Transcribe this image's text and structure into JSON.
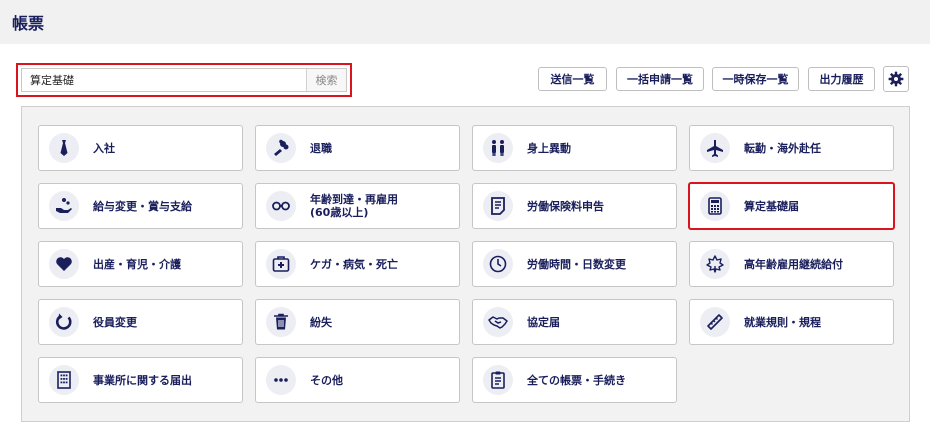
{
  "page": {
    "title": "帳票"
  },
  "search": {
    "value": "算定基礎",
    "button_label": "検索"
  },
  "toolbar": {
    "buttons": [
      {
        "label": "送信一覧"
      },
      {
        "label": "一括申請一覧"
      },
      {
        "label": "一時保存一覧"
      },
      {
        "label": "出力履歴"
      }
    ],
    "settings_icon": "gear-icon"
  },
  "tiles": [
    {
      "label": "入社",
      "icon": "necktie-icon"
    },
    {
      "label": "退職",
      "icon": "bouquet-icon"
    },
    {
      "label": "身上異動",
      "icon": "family-icon"
    },
    {
      "label": "転勤・海外赴任",
      "icon": "airplane-icon"
    },
    {
      "label": "給与変更・賞与支給",
      "icon": "hand-coins-icon"
    },
    {
      "label": "年齢到達・再雇用\n(60歳以上)",
      "icon": "glasses-icon"
    },
    {
      "label": "労働保険料申告",
      "icon": "document-icon"
    },
    {
      "label": "算定基礎届",
      "icon": "calculator-icon"
    },
    {
      "label": "出産・育児・介護",
      "icon": "heart-icon"
    },
    {
      "label": "ケガ・病気・死亡",
      "icon": "first-aid-icon"
    },
    {
      "label": "労働時間・日数変更",
      "icon": "clock-icon"
    },
    {
      "label": "高年齢雇用継続給付",
      "icon": "leaf-icon"
    },
    {
      "label": "役員変更",
      "icon": "refresh-icon"
    },
    {
      "label": "紛失",
      "icon": "trash-icon"
    },
    {
      "label": "協定届",
      "icon": "handshake-icon"
    },
    {
      "label": "就業規則・規程",
      "icon": "ruler-icon"
    },
    {
      "label": "事業所に関する届出",
      "icon": "building-icon"
    },
    {
      "label": "その他",
      "icon": "more-icon"
    },
    {
      "label": "全ての帳票・手続き",
      "icon": "clipboard-icon"
    }
  ],
  "colors": {
    "accent": "#1a1f5c",
    "highlight": "#d9141e",
    "panel_bg": "#f2f2f2",
    "header_bg": "#f1f1f1"
  }
}
